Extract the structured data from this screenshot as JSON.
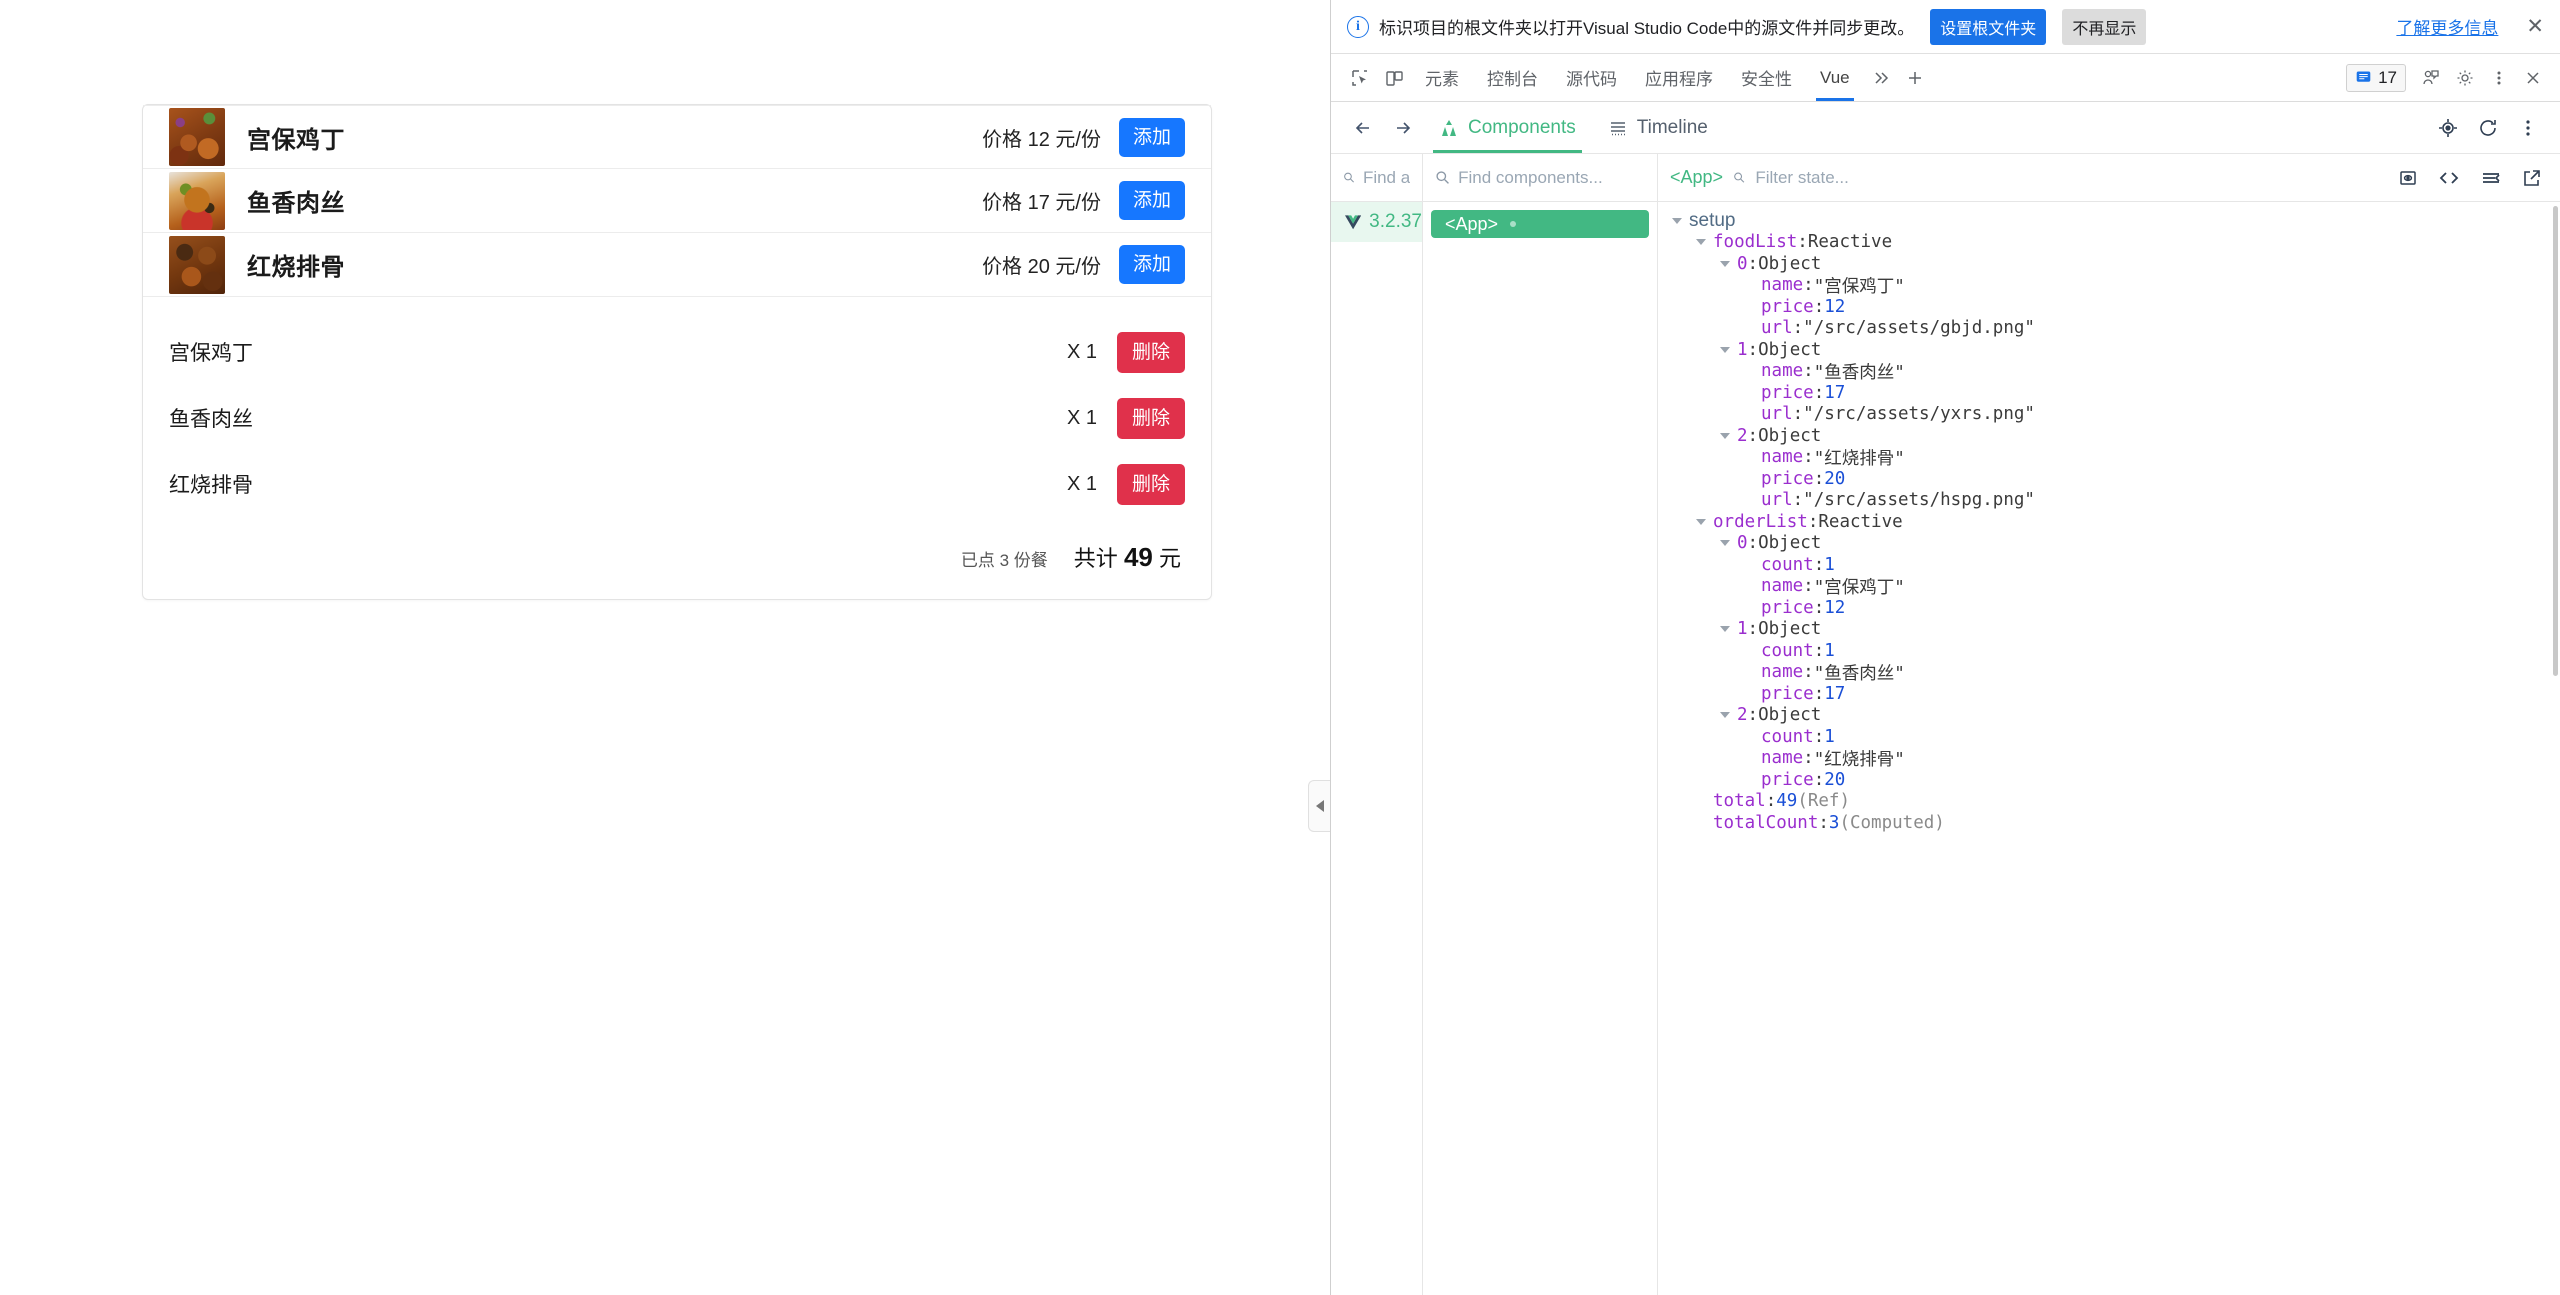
{
  "page": {
    "food_list": [
      {
        "name": "宫保鸡丁",
        "price_label": "价格 12 元/份",
        "add_label": "添加"
      },
      {
        "name": "鱼香肉丝",
        "price_label": "价格 17 元/份",
        "add_label": "添加"
      },
      {
        "name": "红烧排骨",
        "price_label": "价格 20 元/份",
        "add_label": "添加"
      }
    ],
    "order_list": [
      {
        "name": "宫保鸡丁",
        "count_label": "X 1",
        "delete_label": "删除"
      },
      {
        "name": "鱼香肉丝",
        "count_label": "X 1",
        "delete_label": "删除"
      },
      {
        "name": "红烧排骨",
        "count_label": "X 1",
        "delete_label": "删除"
      }
    ],
    "summary": {
      "count_label": "已点 3 份餐",
      "total_prefix": "共计",
      "total_value": "49",
      "total_suffix": "元"
    },
    "colors": {
      "add_button": "#1677ff",
      "delete_button": "#e0314b"
    }
  },
  "infobar": {
    "icon": "info-icon",
    "message": "标识项目的根文件夹以打开Visual Studio Code中的源文件并同步更改。",
    "primary_label": "设置根文件夹",
    "secondary_label": "不再显示",
    "link_label": "了解更多信息",
    "close_label": "✕"
  },
  "devtools_tabs": {
    "inspect_icon": "inspect-element-icon",
    "device_icon": "device-toolbar-icon",
    "tabs": [
      {
        "label": "元素",
        "active": false
      },
      {
        "label": "控制台",
        "active": false
      },
      {
        "label": "源代码",
        "active": false
      },
      {
        "label": "应用程序",
        "active": false
      },
      {
        "label": "安全性",
        "active": false
      },
      {
        "label": "Vue",
        "active": true
      }
    ],
    "more_tabs_icon": "chevron-double-right-icon",
    "add_tab_icon": "plus-icon",
    "issues_count": "17",
    "feedback_icon": "feedback-icon",
    "settings_icon": "gear-icon",
    "more_icon": "more-vertical-icon",
    "close_icon": "close-icon"
  },
  "vue_panel": {
    "back_icon": "arrow-left-icon",
    "forward_icon": "arrow-right-icon",
    "tabs": [
      {
        "label": "Components",
        "icon": "vue-components-icon",
        "active": true
      },
      {
        "label": "Timeline",
        "icon": "timeline-icon",
        "active": false
      }
    ],
    "target_icon": "select-component-icon",
    "refresh_icon": "refresh-icon",
    "menu_icon": "more-vertical-icon"
  },
  "search": {
    "tree_placeholder": "Find a",
    "components_placeholder": "Find components...",
    "state_placeholder": "Filter state...",
    "selected_component": "<App>",
    "actions": [
      {
        "name": "inspect-dom-icon"
      },
      {
        "name": "open-in-editor-icon"
      },
      {
        "name": "collapse-all-icon"
      },
      {
        "name": "external-link-icon"
      }
    ]
  },
  "version_panel": {
    "logo": "vue-logo-icon",
    "version": "3.2.37"
  },
  "component_tree": {
    "root_label": "<App>"
  },
  "state_tree": [
    {
      "indent": 0,
      "caret": "open",
      "text": "setup",
      "style": "setup"
    },
    {
      "indent": 1,
      "caret": "open",
      "key": "foodList",
      "sep": ": ",
      "value": "Reactive",
      "vstyle": "type"
    },
    {
      "indent": 2,
      "caret": "open",
      "key": "0",
      "sep": ": ",
      "value": "Object",
      "vstyle": "type",
      "kstyle": "num"
    },
    {
      "indent": 3,
      "caret": "none",
      "key": "name",
      "sep": ": ",
      "value": "\"宫保鸡丁\"",
      "vstyle": "str"
    },
    {
      "indent": 3,
      "caret": "none",
      "key": "price",
      "sep": ": ",
      "value": "12",
      "vstyle": "num"
    },
    {
      "indent": 3,
      "caret": "none",
      "key": "url",
      "sep": ": ",
      "value": "\"/src/assets/gbjd.png\"",
      "vstyle": "str"
    },
    {
      "indent": 2,
      "caret": "open",
      "key": "1",
      "sep": ": ",
      "value": "Object",
      "vstyle": "type",
      "kstyle": "num"
    },
    {
      "indent": 3,
      "caret": "none",
      "key": "name",
      "sep": ": ",
      "value": "\"鱼香肉丝\"",
      "vstyle": "str"
    },
    {
      "indent": 3,
      "caret": "none",
      "key": "price",
      "sep": ": ",
      "value": "17",
      "vstyle": "num"
    },
    {
      "indent": 3,
      "caret": "none",
      "key": "url",
      "sep": ": ",
      "value": "\"/src/assets/yxrs.png\"",
      "vstyle": "str"
    },
    {
      "indent": 2,
      "caret": "open",
      "key": "2",
      "sep": ": ",
      "value": "Object",
      "vstyle": "type",
      "kstyle": "num"
    },
    {
      "indent": 3,
      "caret": "none",
      "key": "name",
      "sep": ": ",
      "value": "\"红烧排骨\"",
      "vstyle": "str"
    },
    {
      "indent": 3,
      "caret": "none",
      "key": "price",
      "sep": ": ",
      "value": "20",
      "vstyle": "num"
    },
    {
      "indent": 3,
      "caret": "none",
      "key": "url",
      "sep": ": ",
      "value": "\"/src/assets/hspg.png\"",
      "vstyle": "str"
    },
    {
      "indent": 1,
      "caret": "open",
      "key": "orderList",
      "sep": ": ",
      "value": "Reactive",
      "vstyle": "type"
    },
    {
      "indent": 2,
      "caret": "open",
      "key": "0",
      "sep": ": ",
      "value": "Object",
      "vstyle": "type",
      "kstyle": "num"
    },
    {
      "indent": 3,
      "caret": "none",
      "key": "count",
      "sep": ": ",
      "value": "1",
      "vstyle": "num"
    },
    {
      "indent": 3,
      "caret": "none",
      "key": "name",
      "sep": ": ",
      "value": "\"宫保鸡丁\"",
      "vstyle": "str"
    },
    {
      "indent": 3,
      "caret": "none",
      "key": "price",
      "sep": ": ",
      "value": "12",
      "vstyle": "num"
    },
    {
      "indent": 2,
      "caret": "open",
      "key": "1",
      "sep": ": ",
      "value": "Object",
      "vstyle": "type",
      "kstyle": "num"
    },
    {
      "indent": 3,
      "caret": "none",
      "key": "count",
      "sep": ": ",
      "value": "1",
      "vstyle": "num"
    },
    {
      "indent": 3,
      "caret": "none",
      "key": "name",
      "sep": ": ",
      "value": "\"鱼香肉丝\"",
      "vstyle": "str"
    },
    {
      "indent": 3,
      "caret": "none",
      "key": "price",
      "sep": ": ",
      "value": "17",
      "vstyle": "num"
    },
    {
      "indent": 2,
      "caret": "open",
      "key": "2",
      "sep": ": ",
      "value": "Object",
      "vstyle": "type",
      "kstyle": "num",
      "cursor": true
    },
    {
      "indent": 3,
      "caret": "none",
      "key": "count",
      "sep": ": ",
      "value": "1",
      "vstyle": "num"
    },
    {
      "indent": 3,
      "caret": "none",
      "key": "name",
      "sep": ": ",
      "value": "\"红烧排骨\"",
      "vstyle": "str"
    },
    {
      "indent": 3,
      "caret": "none",
      "key": "price",
      "sep": ": ",
      "value": "20",
      "vstyle": "num"
    },
    {
      "indent": 1,
      "caret": "none",
      "key": "total",
      "sep": ": ",
      "value": "49",
      "vstyle": "num",
      "meta": " (Ref)"
    },
    {
      "indent": 1,
      "caret": "none",
      "key": "totalCount",
      "sep": ": ",
      "value": "3",
      "vstyle": "num",
      "meta": " (Computed)"
    }
  ]
}
